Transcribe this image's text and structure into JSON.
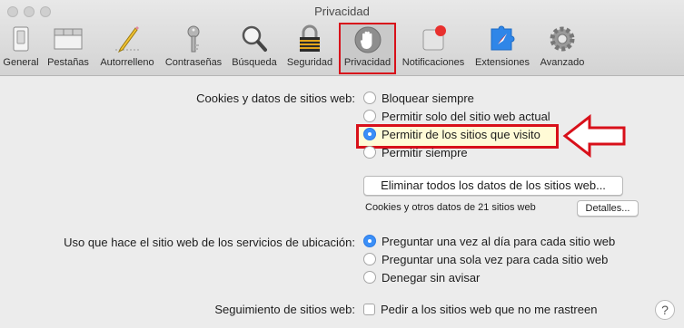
{
  "window": {
    "title": "Privacidad"
  },
  "toolbar": {
    "items": [
      {
        "label": "General",
        "icon": "general-switch-icon"
      },
      {
        "label": "Pestañas",
        "icon": "tabs-icon"
      },
      {
        "label": "Autorrelleno",
        "icon": "pencil-icon"
      },
      {
        "label": "Contraseñas",
        "icon": "key-icon"
      },
      {
        "label": "Búsqueda",
        "icon": "magnifier-icon"
      },
      {
        "label": "Seguridad",
        "icon": "lock-icon"
      },
      {
        "label": "Privacidad",
        "icon": "hand-icon",
        "selected": true
      },
      {
        "label": "Notificaciones",
        "icon": "notifications-icon"
      },
      {
        "label": "Extensiones",
        "icon": "puzzle-icon"
      },
      {
        "label": "Avanzado",
        "icon": "gear-icon"
      }
    ]
  },
  "cookies": {
    "label": "Cookies y datos de sitios web:",
    "options": [
      {
        "label": "Bloquear siempre",
        "selected": false
      },
      {
        "label": "Permitir solo del sitio web actual",
        "selected": false
      },
      {
        "label": "Permitir de los sitios que visito",
        "selected": true
      },
      {
        "label": "Permitir siempre",
        "selected": false
      }
    ],
    "remove_button": "Eliminar todos los datos de los sitios web...",
    "info_text": "Cookies y otros datos de 21 sitios web",
    "details_button": "Detalles..."
  },
  "location": {
    "label": "Uso que hace el sitio web de los servicios de ubicación:",
    "options": [
      {
        "label": "Preguntar una vez al día para cada sitio web",
        "selected": true
      },
      {
        "label": "Preguntar una sola vez para cada sitio web",
        "selected": false
      },
      {
        "label": "Denegar sin avisar",
        "selected": false
      }
    ]
  },
  "tracking": {
    "label": "Seguimiento de sitios web:",
    "checkbox_label": "Pedir a los sitios web que no me rastreen",
    "checked": false
  },
  "help": {
    "label": "?"
  },
  "colors": {
    "accent": "#3b8ff7",
    "annotation_red": "#d8101a"
  }
}
